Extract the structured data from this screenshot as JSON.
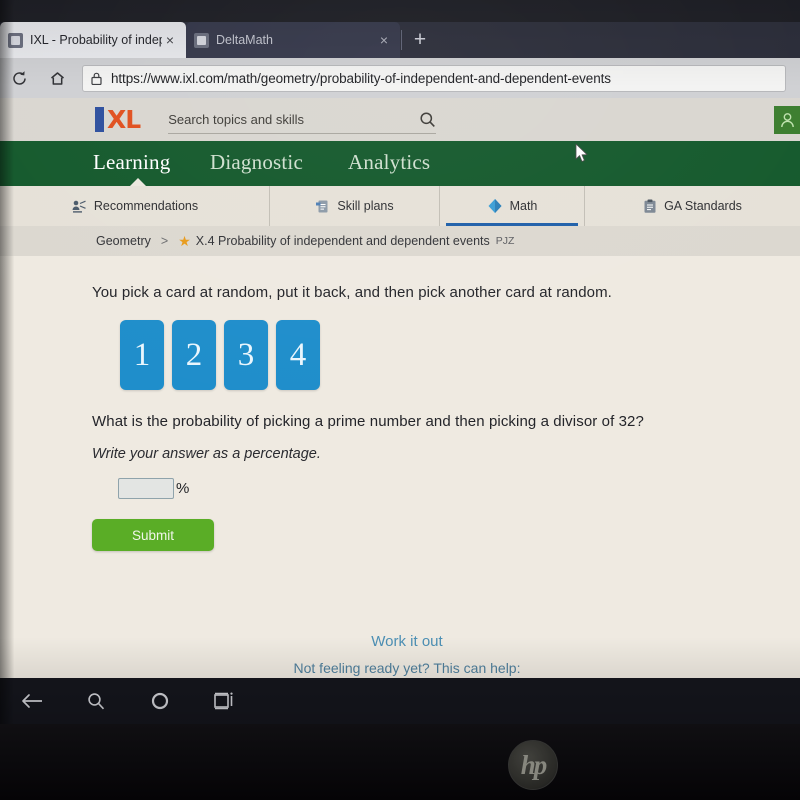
{
  "browser": {
    "tabs": [
      {
        "title": "IXL - Probability of independent",
        "close_label": "×",
        "favicon": "ixl-favicon",
        "active": true
      },
      {
        "title": "DeltaMath",
        "close_label": "×",
        "favicon": "deltamath-favicon",
        "active": false
      }
    ],
    "newtab_label": "+",
    "toolbar": {
      "reload_icon": "reload-icon",
      "home_icon": "home-icon",
      "lock_icon": "lock-icon",
      "url": "https://www.ixl.com/math/geometry/probability-of-independent-and-dependent-events"
    }
  },
  "site": {
    "logo": {
      "letter_i": "I",
      "letters_xl": "XL"
    },
    "search": {
      "placeholder": "Search topics and skills",
      "icon": "search-icon"
    },
    "account": {
      "icon": "user-avatar-icon"
    },
    "primary_nav": [
      {
        "label": "Learning",
        "active": true
      },
      {
        "label": "Diagnostic",
        "active": false
      },
      {
        "label": "Analytics",
        "active": false
      }
    ],
    "secondary_nav": [
      {
        "label": "Recommendations",
        "icon": "recommendations-icon",
        "active": false
      },
      {
        "label": "Skill plans",
        "icon": "skill-plans-icon",
        "active": false
      },
      {
        "label": "Math",
        "icon": "math-diamond-icon",
        "active": true
      },
      {
        "label": "GA Standards",
        "icon": "clipboard-icon",
        "active": false
      }
    ],
    "breadcrumb": {
      "subject": "Geometry",
      "separator": ">",
      "star_icon": "star-icon",
      "skill": "X.4 Probability of independent and dependent events",
      "code": "PJZ"
    }
  },
  "question": {
    "intro": "You pick a card at random, put it back, and then pick another card at random.",
    "cards": [
      "1",
      "2",
      "3",
      "4"
    ],
    "prompt": "What is the probability of picking a prime number and then picking a divisor of 32?",
    "instruction": "Write your answer as a percentage.",
    "answer": {
      "value": "",
      "placeholder": "",
      "suffix": "%"
    },
    "submit_label": "Submit"
  },
  "help": {
    "work_it_out": "Work it out",
    "not_ready": "Not feeling ready yet? This can help:"
  },
  "system_nav": [
    {
      "icon": "back-arrow-icon",
      "name": "back"
    },
    {
      "icon": "search-icon",
      "name": "search"
    },
    {
      "icon": "cortana-circle-icon",
      "name": "cortana"
    },
    {
      "icon": "task-view-icon",
      "name": "task-view"
    }
  ],
  "device": {
    "brand": "hp"
  },
  "colors": {
    "nav_green": "#14592c",
    "card_blue": "#1f8ecb",
    "submit_green": "#5aad26",
    "logo_orange": "#e0501e",
    "logo_blue": "#2d4f9e",
    "active_underline": "#1f5fa9",
    "link_blue": "#4c8fb4"
  }
}
